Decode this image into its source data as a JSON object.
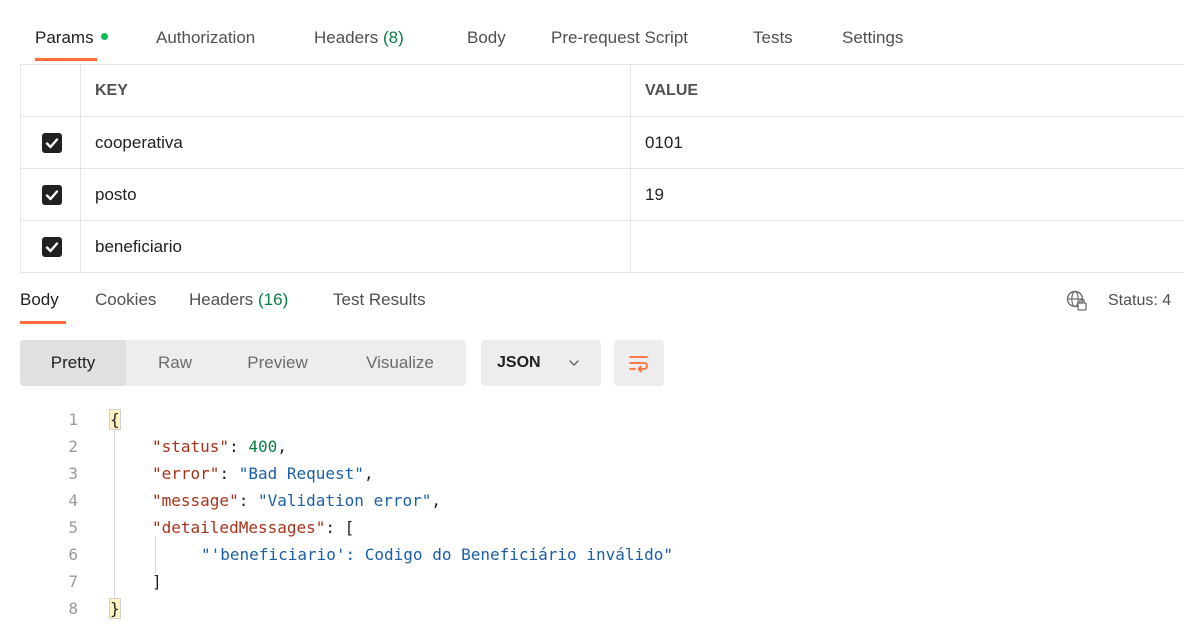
{
  "request_tabs": [
    {
      "label": "Params",
      "dot": true
    },
    {
      "label": "Authorization"
    },
    {
      "label": "Headers",
      "count": "(8)"
    },
    {
      "label": "Body"
    },
    {
      "label": "Pre-request Script"
    },
    {
      "label": "Tests"
    },
    {
      "label": "Settings"
    }
  ],
  "colors": {
    "accent": "#ff6c37",
    "dot": "#0cbb52",
    "count": "#0a7d47",
    "key_token": "#a8331a",
    "number_token": "#0a7d47",
    "string_token": "#1c5fa8"
  },
  "params": {
    "columns": [
      "KEY",
      "VALUE"
    ],
    "rows": [
      {
        "checked": true,
        "key": "cooperativa",
        "value": "0101"
      },
      {
        "checked": true,
        "key": "posto",
        "value": "19"
      },
      {
        "checked": true,
        "key": "beneficiario",
        "value": ""
      }
    ]
  },
  "response_tabs": [
    {
      "label": "Body"
    },
    {
      "label": "Cookies"
    },
    {
      "label": "Headers",
      "count": "(16)"
    },
    {
      "label": "Test Results"
    }
  ],
  "status_label": "Status: 4",
  "view_modes": [
    "Pretty",
    "Raw",
    "Preview",
    "Visualize"
  ],
  "format_select": "JSON",
  "icons": {
    "globe": "globe-lock-icon",
    "chevron": "chevron-down-icon",
    "wrap": "wrap-lines-icon",
    "check": "check-icon"
  },
  "code": {
    "line_numbers": [
      "1",
      "2",
      "3",
      "4",
      "5",
      "6",
      "7",
      "8"
    ],
    "open_brace": "{",
    "close_brace": "}",
    "status_key": "\"status\"",
    "status_value": "400",
    "error_key": "\"error\"",
    "error_value": "\"Bad Request\"",
    "message_key": "\"message\"",
    "message_value": "\"Validation error\"",
    "detailed_key": "\"detailedMessages\"",
    "open_bracket": "[",
    "detailed_item": "\"'beneficiario': Codigo do Beneficiário inválido\"",
    "close_bracket": "]"
  }
}
